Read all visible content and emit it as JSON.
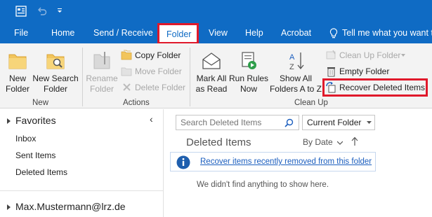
{
  "menu": {
    "file": "File",
    "home": "Home",
    "send_receive": "Send / Receive",
    "folder": "Folder",
    "view": "View",
    "help": "Help",
    "acrobat": "Acrobat",
    "tell_me": "Tell me what you want t"
  },
  "ribbon": {
    "new_group": {
      "label": "New",
      "new_folder": [
        "New",
        "Folder"
      ],
      "new_search_folder": [
        "New Search",
        "Folder"
      ]
    },
    "actions_group": {
      "label": "Actions",
      "rename_folder": [
        "Rename",
        "Folder"
      ],
      "copy_folder": "Copy Folder",
      "move_folder": "Move Folder",
      "delete_folder": "Delete Folder"
    },
    "cleanup_group": {
      "label": "Clean Up",
      "mark_all_as_read": [
        "Mark All",
        "as Read"
      ],
      "run_rules_now": [
        "Run Rules",
        "Now"
      ],
      "show_all_folders": [
        "Show All",
        "Folders A to Z"
      ],
      "clean_up_folder": "Clean Up Folder",
      "empty_folder": "Empty Folder",
      "recover_deleted_items": "Recover Deleted Items"
    }
  },
  "folder_pane": {
    "favorites": "Favorites",
    "items": [
      "Inbox",
      "Sent Items",
      "Deleted Items"
    ],
    "account": "Max.Mustermann@lrz.de"
  },
  "message_list": {
    "search_placeholder": "Search Deleted Items",
    "scope": "Current Folder",
    "title": "Deleted Items",
    "sort_by": "By Date",
    "info_link": "Recover items recently removed from this folder",
    "empty_message": "We didn't find anything to show here."
  },
  "colors": {
    "accent": "#0f6bc4",
    "highlight_box": "#e0192b",
    "ribbon_bg": "#f3f3f3",
    "link": "#1a5dbe"
  }
}
